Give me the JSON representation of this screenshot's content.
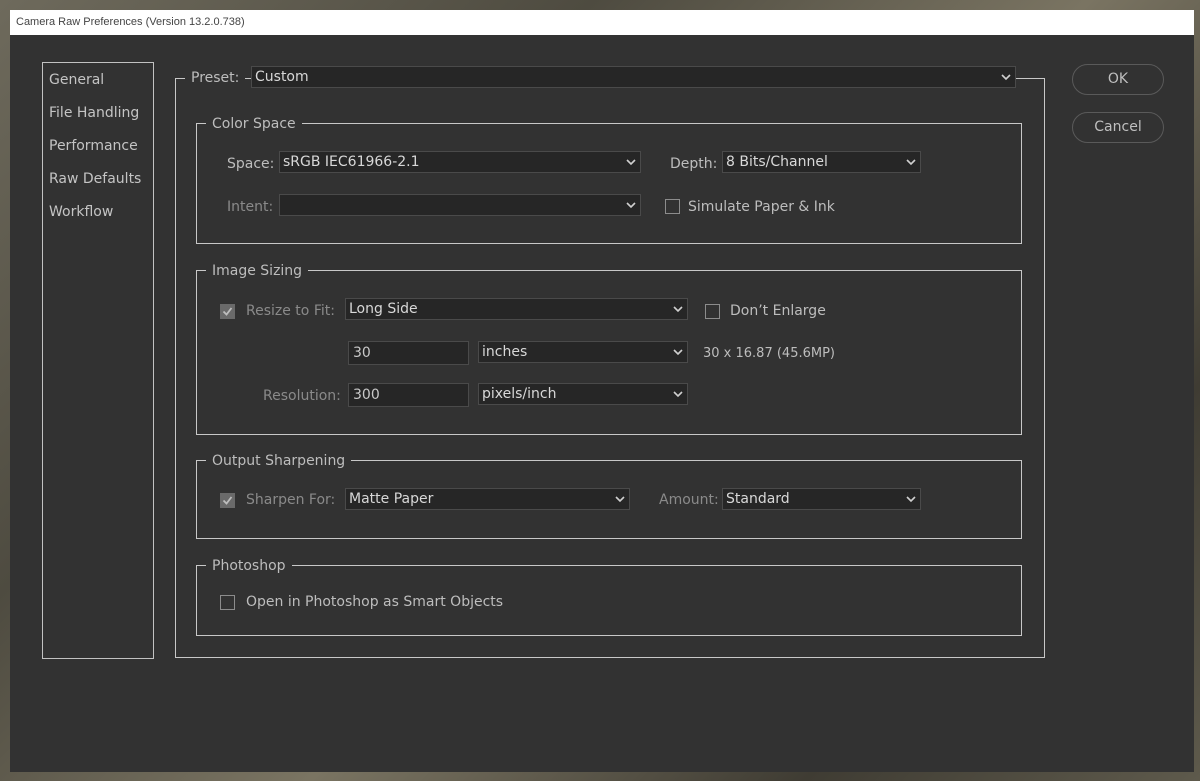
{
  "window": {
    "title": "Camera Raw Preferences  (Version 13.2.0.738)"
  },
  "nav": {
    "items": [
      "General",
      "File Handling",
      "Performance",
      "Raw Defaults",
      "Workflow"
    ]
  },
  "preset": {
    "label": "Preset:",
    "value": "Custom"
  },
  "buttons": {
    "ok": "OK",
    "cancel": "Cancel"
  },
  "color_space": {
    "legend": "Color Space",
    "space_label": "Space:",
    "space_value": "sRGB IEC61966-2.1",
    "depth_label": "Depth:",
    "depth_value": "8 Bits/Channel",
    "intent_label": "Intent:",
    "intent_value": "",
    "simulate_label": "Simulate Paper & Ink",
    "simulate_checked": false
  },
  "image_sizing": {
    "legend": "Image Sizing",
    "resize_label": "Resize to Fit:",
    "resize_checked": true,
    "resize_value": "Long Side",
    "dont_enlarge_label": "Don’t Enlarge",
    "dont_enlarge_checked": false,
    "size_value": "30",
    "size_unit": "inches",
    "dimensions_text": "30 x 16.87 (45.6MP)",
    "resolution_label": "Resolution:",
    "resolution_value": "300",
    "resolution_unit": "pixels/inch"
  },
  "output_sharpening": {
    "legend": "Output Sharpening",
    "sharpen_label": "Sharpen For:",
    "sharpen_checked": true,
    "sharpen_value": "Matte Paper",
    "amount_label": "Amount:",
    "amount_value": "Standard"
  },
  "photoshop": {
    "legend": "Photoshop",
    "smart_objects_label": "Open in Photoshop as Smart Objects",
    "smart_objects_checked": false
  },
  "colors": {
    "dialog_bg": "#323232",
    "field_bg": "#262626",
    "frame": "#c8c8c8",
    "text": "#bdbdbd"
  }
}
